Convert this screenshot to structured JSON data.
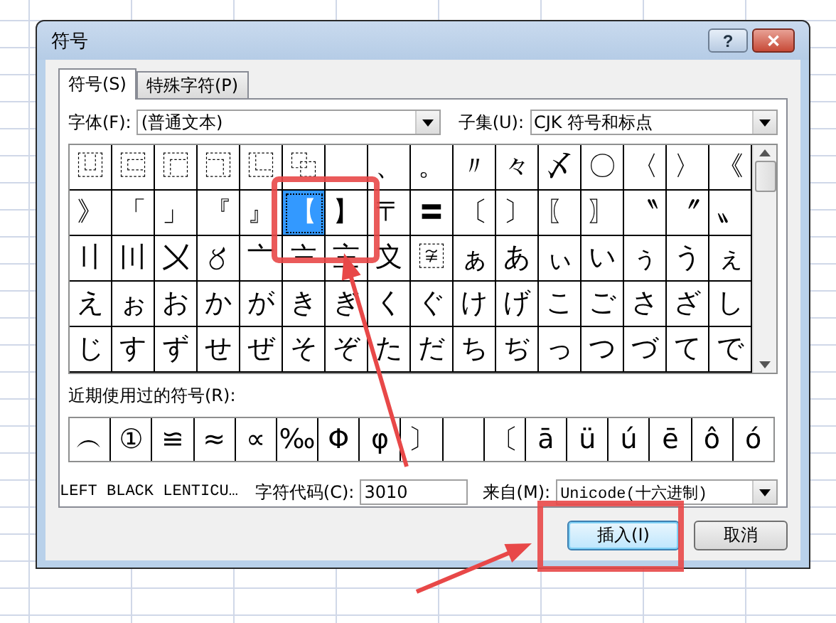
{
  "window": {
    "title": "符号"
  },
  "title_buttons": [
    {
      "kind": "help",
      "label": "?"
    },
    {
      "kind": "close",
      "label": "✕"
    }
  ],
  "tabs": [
    {
      "label": "符号(S)",
      "selected": true
    },
    {
      "label": "特殊字符(P)",
      "selected": false
    }
  ],
  "font": {
    "label": "字体(F):",
    "value": "(普通文本)"
  },
  "subset": {
    "label": "子集(U):",
    "value": "CJK 符号和标点"
  },
  "grid": {
    "rows": [
      [
        {
          "char": "⿶",
          "selected": false
        },
        {
          "char": "⿷",
          "selected": false
        },
        {
          "char": "⿸",
          "selected": false
        },
        {
          "char": "⿹",
          "selected": false
        },
        {
          "char": "⿺",
          "selected": false
        },
        {
          "char": "⿻",
          "selected": false
        },
        {
          "selected": false
        },
        {
          "char": "、",
          "selected": false
        },
        {
          "char": "。",
          "selected": false
        },
        {
          "char": "〃",
          "selected": false
        },
        {
          "char": "々",
          "selected": false
        },
        {
          "char": "〆",
          "selected": false
        },
        {
          "char": "〇",
          "selected": false
        },
        {
          "char": "〈",
          "selected": false
        },
        {
          "char": "〉",
          "selected": false
        },
        {
          "char": "《",
          "selected": false
        }
      ],
      [
        {
          "char": "》",
          "selected": false
        },
        {
          "char": "「",
          "selected": false
        },
        {
          "char": "」",
          "selected": false
        },
        {
          "char": "『",
          "selected": false
        },
        {
          "char": "』",
          "selected": false
        },
        {
          "char": "【",
          "selected": true
        },
        {
          "char": "】",
          "selected": false
        },
        {
          "char": "〒",
          "selected": false
        },
        {
          "char": "〓",
          "selected": false
        },
        {
          "char": "〔",
          "selected": false
        },
        {
          "char": "〕",
          "selected": false
        },
        {
          "char": "〖",
          "selected": false
        },
        {
          "char": "〗",
          "selected": false
        },
        {
          "char": "〝",
          "selected": false
        },
        {
          "char": "〞",
          "selected": false
        },
        {
          "char": "〟",
          "selected": false
        }
      ],
      [
        {
          "char": "〢",
          "selected": false
        },
        {
          "char": "〣",
          "selected": false
        },
        {
          "char": "〤",
          "selected": false
        },
        {
          "char": "〥",
          "selected": false
        },
        {
          "char": "〦",
          "selected": false
        },
        {
          "char": "〧",
          "selected": false
        },
        {
          "char": "〨",
          "selected": false
        },
        {
          "char": "〩",
          "selected": false
        },
        {
          "char": "〾",
          "selected": false
        },
        {
          "char": "ぁ",
          "selected": false
        },
        {
          "char": "あ",
          "selected": false
        },
        {
          "char": "ぃ",
          "selected": false
        },
        {
          "char": "い",
          "selected": false
        },
        {
          "char": "ぅ",
          "selected": false
        },
        {
          "char": "う",
          "selected": false
        },
        {
          "char": "ぇ",
          "selected": false
        }
      ],
      [
        {
          "char": "え",
          "selected": false
        },
        {
          "char": "ぉ",
          "selected": false
        },
        {
          "char": "お",
          "selected": false
        },
        {
          "char": "か",
          "selected": false
        },
        {
          "char": "が",
          "selected": false
        },
        {
          "char": "き",
          "selected": false
        },
        {
          "char": "ぎ",
          "selected": false
        },
        {
          "char": "く",
          "selected": false
        },
        {
          "char": "ぐ",
          "selected": false
        },
        {
          "char": "け",
          "selected": false
        },
        {
          "char": "げ",
          "selected": false
        },
        {
          "char": "こ",
          "selected": false
        },
        {
          "char": "ご",
          "selected": false
        },
        {
          "char": "さ",
          "selected": false
        },
        {
          "char": "ざ",
          "selected": false
        },
        {
          "char": "し",
          "selected": false
        }
      ],
      [
        {
          "char": "じ",
          "selected": false
        },
        {
          "char": "す",
          "selected": false
        },
        {
          "char": "ず",
          "selected": false
        },
        {
          "char": "せ",
          "selected": false
        },
        {
          "char": "ぜ",
          "selected": false
        },
        {
          "char": "そ",
          "selected": false
        },
        {
          "char": "ぞ",
          "selected": false
        },
        {
          "char": "た",
          "selected": false
        },
        {
          "char": "だ",
          "selected": false
        },
        {
          "char": "ち",
          "selected": false
        },
        {
          "char": "ぢ",
          "selected": false
        },
        {
          "char": "っ",
          "selected": false
        },
        {
          "char": "つ",
          "selected": false
        },
        {
          "char": "づ",
          "selected": false
        },
        {
          "char": "て",
          "selected": false
        },
        {
          "char": "で",
          "selected": false
        }
      ]
    ]
  },
  "recent": {
    "label": "近期使用过的符号(R):",
    "cells": [
      {
        "kind": "symbol",
        "char": "︵"
      },
      {
        "kind": "symbol",
        "char": "①"
      },
      {
        "kind": "symbol",
        "char": "≌"
      },
      {
        "kind": "symbol",
        "char": "≈"
      },
      {
        "kind": "symbol",
        "char": "∝"
      },
      {
        "kind": "symbol",
        "char": "‰"
      },
      {
        "kind": "symbol",
        "char": "Φ"
      },
      {
        "kind": "symbol",
        "char": "φ"
      },
      {
        "kind": "symbol",
        "char": "〕"
      },
      {
        "kind": "blank"
      },
      {
        "kind": "symbol",
        "char": "〔"
      },
      {
        "kind": "symbol",
        "char": "ā"
      },
      {
        "kind": "symbol",
        "char": "ü"
      },
      {
        "kind": "symbol",
        "char": "ú"
      },
      {
        "kind": "symbol",
        "char": "ē"
      },
      {
        "kind": "symbol",
        "char": "ô"
      },
      {
        "kind": "symbol",
        "char": "ó"
      }
    ]
  },
  "char_name": "LEFT BLACK LENTICU…",
  "char_code": {
    "label": "字符代码(C):",
    "value": "3010"
  },
  "from": {
    "label": "来自(M):",
    "value": "Unicode(十六进制)"
  },
  "buttons": [
    {
      "label": "插入(I)",
      "kind": "default"
    },
    {
      "label": "取消",
      "kind": "normal"
    }
  ]
}
